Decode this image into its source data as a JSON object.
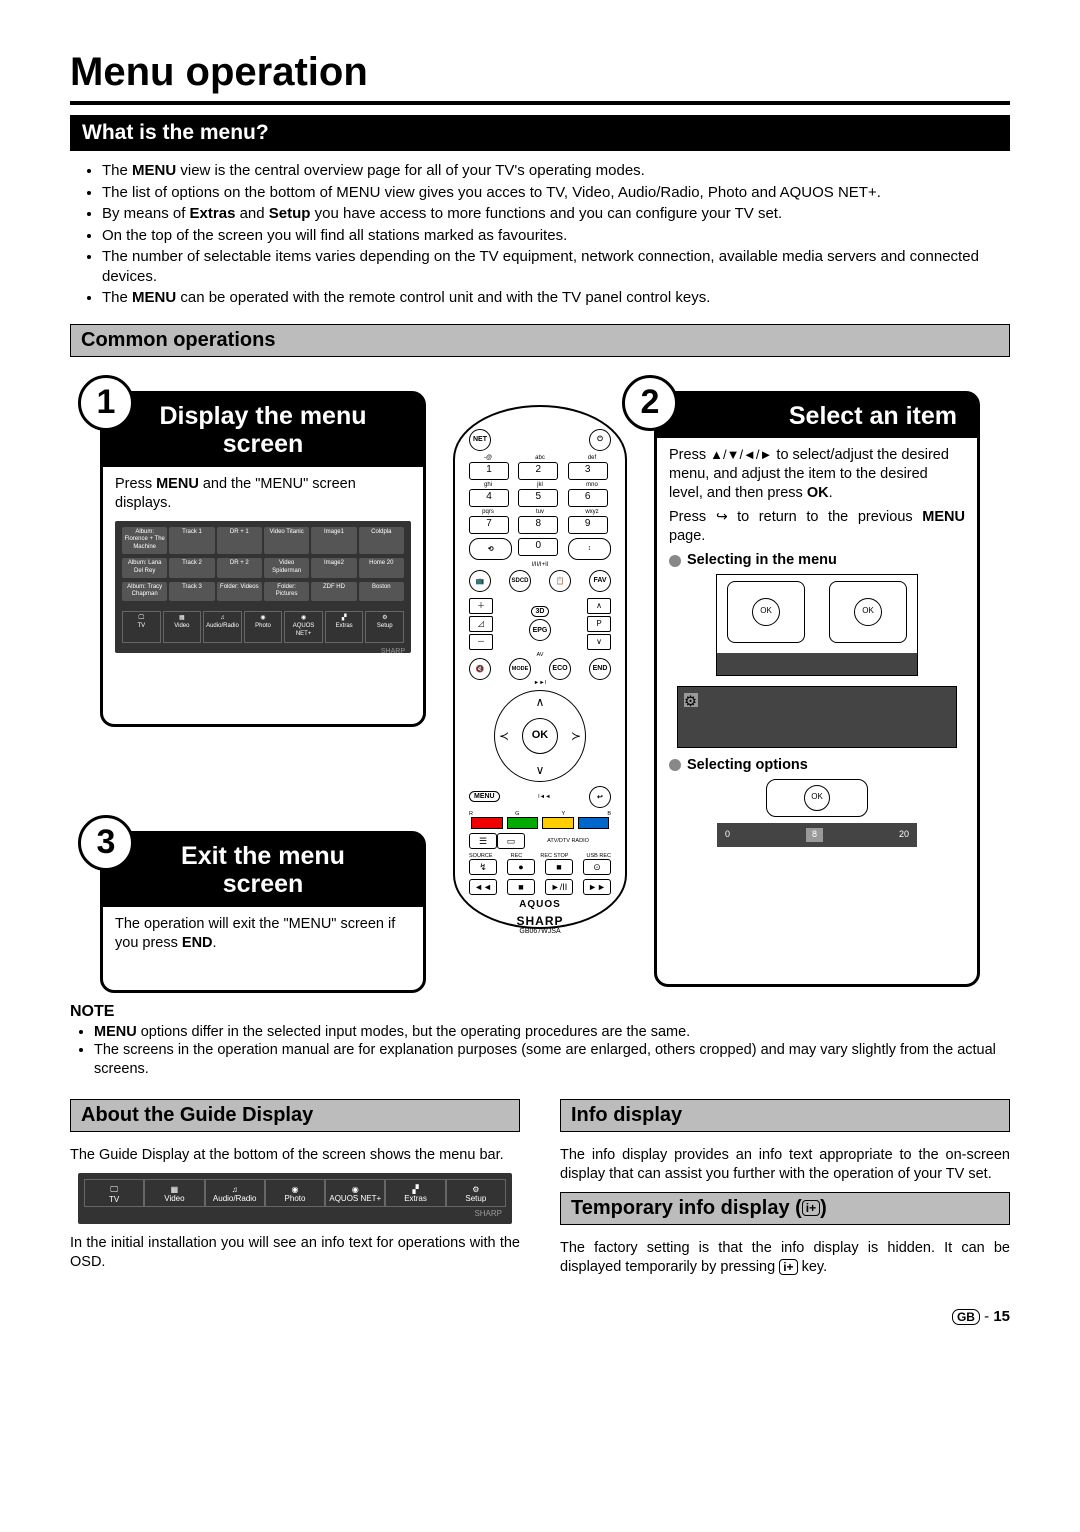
{
  "page": {
    "title": "Menu operation",
    "section1": "What is the menu?",
    "section2": "Common operations",
    "section_about": "About the Guide Display",
    "section_info": "Info display",
    "section_temp": "Temporary info display (",
    "section_temp_icon": "i+",
    "section_temp_end": ")"
  },
  "bullets": {
    "b1a": "The ",
    "b1b": "MENU",
    "b1c": " view is the central overview page for all of your TV's operating modes.",
    "b2": "The list of options on the bottom of MENU  view gives you acces to TV, Video, Audio/Radio, Photo and AQUOS NET+.",
    "b3a": "By means of ",
    "b3b": "Extras",
    "b3c": " and ",
    "b3d": "Setup",
    "b3e": " you have access to more functions and you can configure your TV set.",
    "b4": "On the top of the screen you will find all stations marked as favourites.",
    "b5": "The number of selectable items varies depending on the TV equipment, network connection, available media servers and connected devices.",
    "b6a": "The ",
    "b6b": "MENU",
    "b6c": " can be operated with the remote control unit and with the TV panel control keys."
  },
  "step1": {
    "num": "1",
    "title": "Display the menu screen",
    "body_a": "Press ",
    "body_b": "MENU",
    "body_c": " and the \"MENU\" screen displays."
  },
  "step2": {
    "num": "2",
    "title": "Select an item",
    "body1a": "Press ",
    "arrows": "▲/▼/◄/►",
    "body1b": " to select/adjust the desired menu, and adjust the item to the desired level, and then press ",
    "body1c": "OK",
    "body1d": ".",
    "body2a": "Press  ",
    "back": "⤴",
    "body2b": "  to return to the previous ",
    "body2c": "MENU",
    "body2d": " page.",
    "sub1": "Selecting in the menu",
    "sub2": "Selecting options"
  },
  "step3": {
    "num": "3",
    "title": "Exit the menu screen",
    "body_a": "The operation will exit the \"MENU\" screen if you press ",
    "body_b": "END",
    "body_c": "."
  },
  "remote": {
    "net": "NET",
    "power": "⏻",
    "num_labels_top": [
      "-@",
      "abc",
      "def"
    ],
    "nums_1": [
      "1",
      "2",
      "3"
    ],
    "num_labels_2": [
      "ghi",
      "jkl",
      "mno"
    ],
    "nums_2": [
      "4",
      "5",
      "6"
    ],
    "num_labels_3": [
      "pqrs",
      "tuv",
      "wxyz"
    ],
    "nums_3": [
      "7",
      "8",
      "9"
    ],
    "nums_4": "0",
    "fav": "FAV",
    "btn_3d": "3D",
    "epg": "EPG",
    "p": "P",
    "av": "AV",
    "mode": "MODE",
    "eco": "ECO",
    "end": "END",
    "ok": "OK",
    "menu": "MENU",
    "r": "R",
    "g": "G",
    "y": "Y",
    "b": "B",
    "atv": "ATV/DTV RADIO",
    "src_labels": [
      "SOURCE",
      "REC",
      "REC STOP",
      "USB REC"
    ],
    "play_labels": [
      "◄◄",
      "■",
      "►/II",
      "►►"
    ],
    "brand1": "AQUOS",
    "brand2": "SHARP",
    "model": "GB067WJSA"
  },
  "menu_diagram": {
    "rows": [
      [
        "Album: Florence + The Machine",
        "Track 1",
        "DR + 1",
        "Video Titanic",
        "Image1",
        "Coldpla"
      ],
      [
        "Album: Lana Del Rey",
        "Track 2",
        "DR + 2",
        "Video Spiderman",
        "Image2",
        "Home 20"
      ],
      [
        "Album: Tracy Chapman",
        "Track 3",
        "Folder: Videos",
        "Folder: Pictures",
        "ZDF HD",
        "Boston"
      ]
    ],
    "icons": [
      "TV",
      "Video",
      "Audio/Radio",
      "Photo",
      "AQUOS NET+",
      "Extras",
      "Setup"
    ],
    "brand": "SHARP"
  },
  "menu_bar": {
    "icons": [
      "TV",
      "Video",
      "Audio/Radio",
      "Photo",
      "AQUOS NET+",
      "Extras",
      "Setup"
    ],
    "brand": "SHARP"
  },
  "note": {
    "label": "NOTE",
    "n1a": "MENU",
    "n1b": " options differ in the selected input modes, but the operating procedures are the same.",
    "n2": "The screens in the operation manual are for explanation purposes (some are enlarged, others cropped) and may vary slightly from the actual screens."
  },
  "about": {
    "p1": "The Guide Display at the bottom of the screen shows the menu bar.",
    "p2": "In the initial installation you will see an info text for operations with the OSD."
  },
  "info": {
    "p1": "The info display provides an info text appropriate to the on-screen display that can assist you further with the operation of your TV set.",
    "p2a": "The factory setting is that the info display is hidden. It can be displayed temporarily by pressing ",
    "p2_icon": "i+",
    "p2b": " key."
  },
  "opt_scale": {
    "a": "0",
    "b": "8",
    "c": "20"
  },
  "footer": {
    "gb": "GB",
    "dash": " - ",
    "page": "15"
  }
}
